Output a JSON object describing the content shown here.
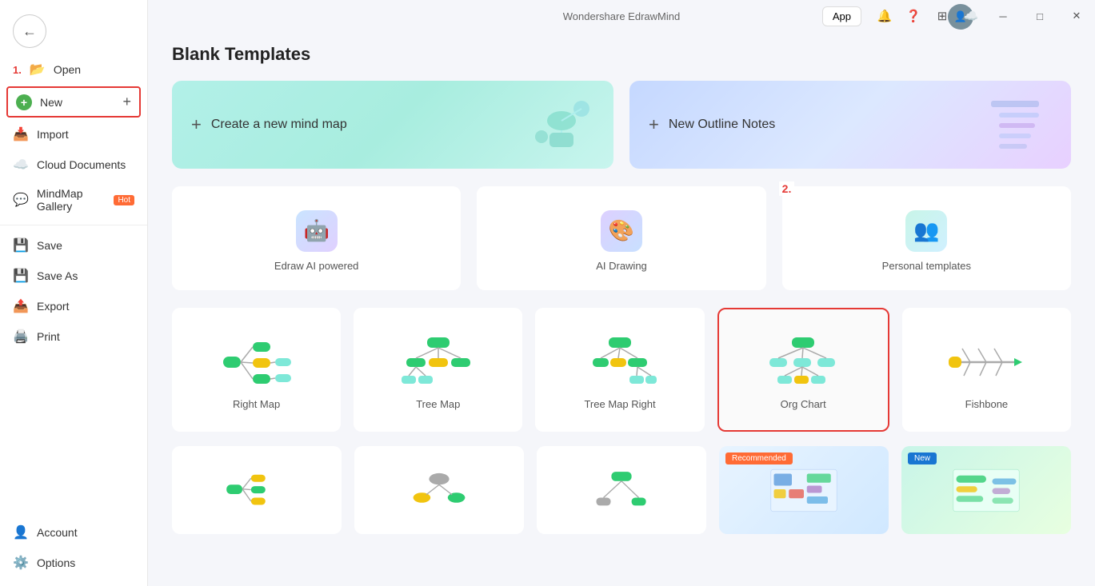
{
  "app": {
    "title": "Wondershare EdrawMind"
  },
  "sidebar": {
    "back_icon": "←",
    "items": [
      {
        "id": "open",
        "label": "Open",
        "icon": "📂",
        "step": "1.",
        "active": false
      },
      {
        "id": "new",
        "label": "New",
        "icon": "",
        "active": true,
        "plus": "+"
      },
      {
        "id": "import",
        "label": "Import",
        "icon": "📥",
        "active": false
      },
      {
        "id": "cloud",
        "label": "Cloud Documents",
        "icon": "☁️",
        "active": false
      },
      {
        "id": "gallery",
        "label": "MindMap Gallery",
        "icon": "💬",
        "hot": "Hot",
        "active": false
      },
      {
        "id": "save",
        "label": "Save",
        "icon": "💾",
        "active": false
      },
      {
        "id": "saveas",
        "label": "Save As",
        "icon": "💾",
        "active": false
      },
      {
        "id": "export",
        "label": "Export",
        "icon": "📤",
        "active": false
      },
      {
        "id": "print",
        "label": "Print",
        "icon": "🖨️",
        "active": false
      }
    ],
    "bottom_items": [
      {
        "id": "account",
        "label": "Account",
        "icon": "👤"
      },
      {
        "id": "options",
        "label": "Options",
        "icon": "⚙️"
      }
    ]
  },
  "header": {
    "app_btn": "App",
    "bell_icon": "🔔",
    "help_icon": "?",
    "grid_icon": "⊞",
    "share_icon": "↑"
  },
  "main": {
    "page_title": "Blank Templates",
    "hero_cards": [
      {
        "id": "new-mind-map",
        "label": "Create a new mind map",
        "plus": "+"
      },
      {
        "id": "new-outline",
        "label": "New Outline Notes",
        "plus": "+"
      }
    ],
    "template_cards": [
      {
        "id": "edraw-ai",
        "label": "Edraw AI powered",
        "icon": "🤖",
        "icon_class": "ai-blue"
      },
      {
        "id": "ai-drawing",
        "label": "AI Drawing",
        "icon": "🎨",
        "icon_class": "ai-purple"
      },
      {
        "id": "personal-templates",
        "label": "Personal templates",
        "icon": "👥",
        "icon_class": "ai-green",
        "step": "2."
      }
    ],
    "map_cards": [
      {
        "id": "right-map",
        "label": "Right Map",
        "highlighted": false
      },
      {
        "id": "tree-map",
        "label": "Tree Map",
        "highlighted": false
      },
      {
        "id": "tree-map-right",
        "label": "Tree Map Right",
        "highlighted": false
      },
      {
        "id": "org-chart",
        "label": "Org Chart",
        "highlighted": true
      },
      {
        "id": "fishbone",
        "label": "Fishbone",
        "highlighted": false
      }
    ],
    "bottom_cards": [
      {
        "id": "bottom-1",
        "label": "",
        "badge": ""
      },
      {
        "id": "bottom-2",
        "label": "",
        "badge": ""
      },
      {
        "id": "bottom-3",
        "label": "",
        "badge": ""
      },
      {
        "id": "recommended",
        "label": "Recommended",
        "badge": "Recommended",
        "type": "recommended"
      },
      {
        "id": "new-card",
        "label": "New",
        "badge": "New",
        "type": "new"
      }
    ]
  },
  "window": {
    "minimize": "─",
    "maximize": "□",
    "close": "✕"
  }
}
